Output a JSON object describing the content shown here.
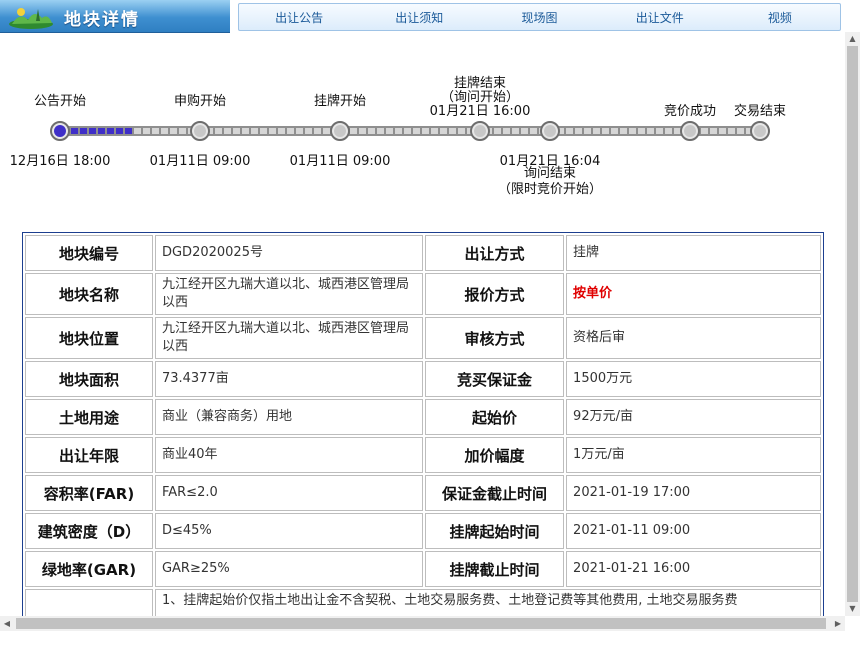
{
  "header": {
    "title": "地块详情",
    "logo_icon": "landscape-logo-icon"
  },
  "nav": [
    "出让公告",
    "出让须知",
    "现场图",
    "出让文件",
    "视频"
  ],
  "timeline": {
    "progress_fraction": 0.1,
    "nodes": [
      {
        "label": "公告开始",
        "time": "12月16日  18:00",
        "active": true
      },
      {
        "label": "申购开始",
        "time": "01月11日  09:00"
      },
      {
        "label": "挂牌开始",
        "time": "01月11日  09:00"
      },
      {
        "label": "挂牌结束",
        "sub": "（询问开始）",
        "time": "01月21日  16:00"
      },
      {
        "label": "询问结束",
        "sub": "（限时竞价开始）",
        "time": "01月21日  16:04"
      },
      {
        "label": "竞价成功"
      },
      {
        "label": "交易结束"
      }
    ]
  },
  "table": {
    "rows": [
      {
        "k1": "地块编号",
        "v1": "DGD2020025号",
        "k2": "出让方式",
        "v2": "挂牌"
      },
      {
        "k1": "地块名称",
        "v1": "九江经开区九瑞大道以北、城西港区管理局以西",
        "k2": "报价方式",
        "v2": "按单价"
      },
      {
        "k1": "地块位置",
        "v1": "九江经开区九瑞大道以北、城西港区管理局以西",
        "k2": "审核方式",
        "v2": "资格后审"
      },
      {
        "k1": "地块面积",
        "v1": "73.4377亩",
        "k2": "竞买保证金",
        "v2": "1500万元"
      },
      {
        "k1": "土地用途",
        "v1": "商业（兼容商务）用地",
        "k2": "起始价",
        "v2": "92万元/亩"
      },
      {
        "k1": "出让年限",
        "v1": "商业40年",
        "k2": "加价幅度",
        "v2": "1万元/亩"
      },
      {
        "k1": "容积率(FAR)",
        "v1": "FAR≤2.0",
        "k2": "保证金截止时间",
        "v2": "2021-01-19 17:00"
      },
      {
        "k1": "建筑密度（D）",
        "v1": "D≤45%",
        "k2": "挂牌起始时间",
        "v2": "2021-01-11 09:00"
      },
      {
        "k1": "绿地率(GAR)",
        "v1": "GAR≥25%",
        "k2": "挂牌截止时间",
        "v2": "2021-01-21 16:00"
      }
    ],
    "note": "1、挂牌起始价仅指土地出让金不含契税、土地交易服务费、土地登记费等其他费用, 土地交易服务费"
  },
  "colors": {
    "red": "#e00000",
    "header_blue": "#3e8fd0",
    "table_border": "#1c3f8f",
    "active_node": "#3f2fc8"
  }
}
